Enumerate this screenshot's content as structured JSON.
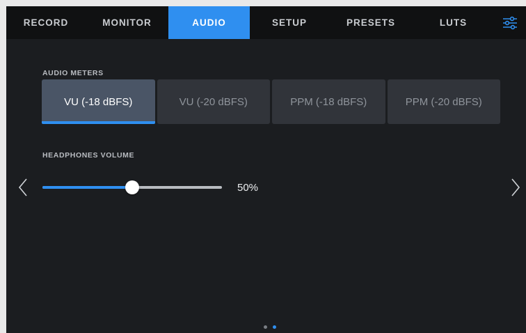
{
  "tabs": [
    {
      "label": "RECORD",
      "active": false
    },
    {
      "label": "MONITOR",
      "active": false
    },
    {
      "label": "AUDIO",
      "active": true
    },
    {
      "label": "SETUP",
      "active": false
    },
    {
      "label": "PRESETS",
      "active": false
    },
    {
      "label": "LUTS",
      "active": false
    }
  ],
  "menu_icon": "settings-sliders-icon",
  "audio_meters": {
    "label": "AUDIO METERS",
    "options": [
      "VU (-18 dBFS)",
      "VU (-20 dBFS)",
      "PPM (-18 dBFS)",
      "PPM (-20 dBFS)"
    ],
    "selected_index": 0
  },
  "headphones": {
    "label": "HEADPHONES VOLUME",
    "value": 50,
    "value_text": "50%"
  },
  "nav": {
    "prev_icon": "chevron-left-icon",
    "next_icon": "chevron-right-icon"
  },
  "pager": {
    "pages": 2,
    "current_index": 1
  },
  "colors": {
    "accent": "#2f8ff0",
    "background": "#1b1d20",
    "tabbar": "#101112",
    "selected_segment": "#4a5566",
    "segment": "#31343a"
  }
}
